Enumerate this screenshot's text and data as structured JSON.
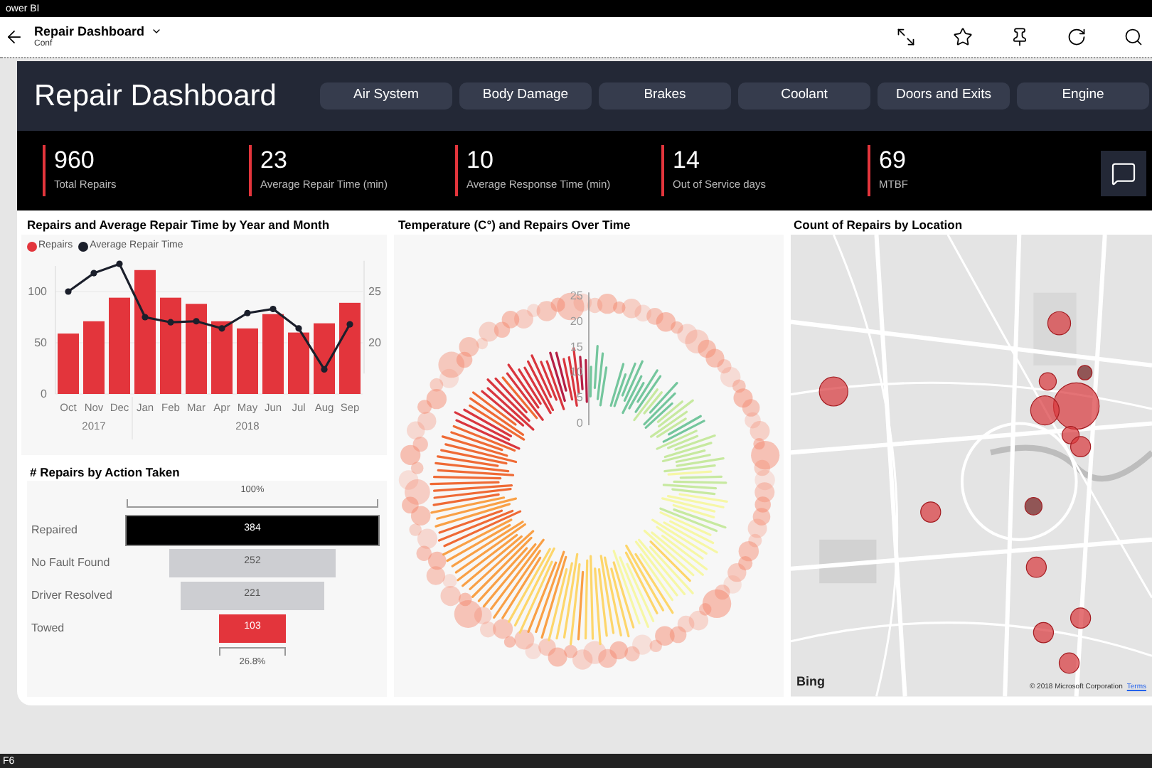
{
  "window": {
    "title": "ower BI"
  },
  "app_bar": {
    "title": "Repair  Dashboard",
    "subtitle": "Conf"
  },
  "header": {
    "title": "Repair Dashboard",
    "filters": [
      {
        "label": "Air System",
        "selected": false
      },
      {
        "label": "Body Damage",
        "selected": false
      },
      {
        "label": "Brakes",
        "selected": false
      },
      {
        "label": "Coolant",
        "selected": false
      },
      {
        "label": "Doors and Exits",
        "selected": false
      },
      {
        "label": "Engine",
        "selected": false
      }
    ]
  },
  "kpis": [
    {
      "value": "960",
      "label": "Total Repairs"
    },
    {
      "value": "23",
      "label": "Average Repair Time (min)"
    },
    {
      "value": "10",
      "label": "Average Response Time (min)"
    },
    {
      "value": "14",
      "label": "Out of Service days"
    },
    {
      "value": "69",
      "label": "MTBF"
    }
  ],
  "combo_panel": {
    "title": "Repairs and Average Repair Time by Year and Month",
    "years": [
      "2017",
      "2018"
    ],
    "bar_chart": {
      "chart_data": {
        "type": "bar",
        "categories": [
          "Oct",
          "Nov",
          "Dec",
          "Jan",
          "Feb",
          "Mar",
          "Apr",
          "May",
          "Jun",
          "Jul",
          "Aug",
          "Sep"
        ],
        "ylim": [
          0,
          125
        ],
        "yticks": [
          0,
          50,
          100
        ],
        "series": [
          {
            "name": "Repairs",
            "color": "#e3353c",
            "values": [
              59,
              71,
              94,
              121,
              94,
              88,
              71,
              64,
              78,
              60,
              69,
              89
            ]
          }
        ]
      }
    },
    "line_chart": {
      "chart_data": {
        "type": "line",
        "ylim": [
          17,
          28
        ],
        "yticks": [
          20,
          25
        ],
        "series": [
          {
            "name": "Average Repair Time",
            "color": "#1b1f2b",
            "marker": "circle",
            "values": [
              25.0,
              26.8,
              27.7,
              22.5,
              22.0,
              22.1,
              21.4,
              22.9,
              23.3,
              21.4,
              17.4,
              21.8
            ]
          }
        ]
      }
    }
  },
  "funnel_panel": {
    "title": "# Repairs by Action Taken",
    "top_percent": "100%",
    "bottom_percent": "26.8%",
    "rows": [
      {
        "label": "Repaired",
        "value": "384",
        "selected": true,
        "color": "#000000"
      },
      {
        "label": "No Fault Found",
        "value": "252",
        "selected": false,
        "color": "#cdced2"
      },
      {
        "label": "Driver Resolved",
        "value": "221",
        "selected": false,
        "color": "#cdced2"
      },
      {
        "label": "Towed",
        "value": "103",
        "selected": false,
        "color": "#e3353c"
      }
    ]
  },
  "radial_panel": {
    "title": "Temperature (C°) and Repairs Over Time",
    "axis_ticks": [
      "25",
      "20",
      "15",
      "10",
      "5",
      "0"
    ]
  },
  "map_panel": {
    "title": "Count of Repairs by Location",
    "provider": "Bing",
    "copyright": "© 2018 Microsoft Corporation",
    "terms": "Terms"
  },
  "taskbar": {
    "text": "F6"
  }
}
